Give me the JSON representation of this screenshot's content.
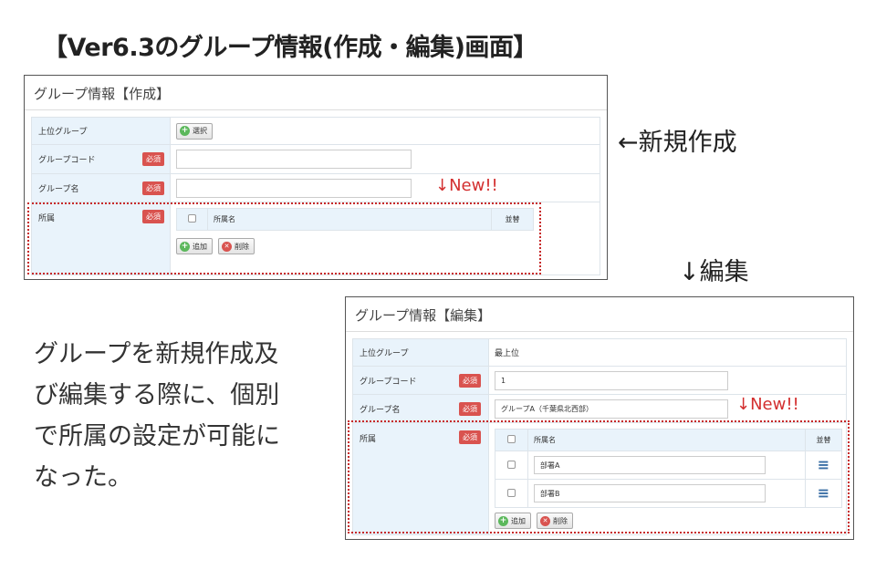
{
  "slide": {
    "title": "【Ver6.3のグループ情報(作成・編集)画面】",
    "create_note": "←新規作成",
    "edit_note": "↓編集",
    "new_marker": "↓New!!",
    "description_lines": [
      "グループを新規作成及",
      "び編集する際に、個別",
      "で所属の設定が可能に",
      "なった。"
    ]
  },
  "create_panel": {
    "heading": "グループ情報【作成】",
    "parent_group_label": "上位グループ",
    "select_button": "選択",
    "group_code_label": "グループコード",
    "group_name_label": "グループ名",
    "affiliation_label": "所属",
    "required_badge": "必須",
    "group_code_value": "",
    "group_name_value": "",
    "table_header_name": "所属名",
    "table_header_sort": "並替",
    "add_button": "追加",
    "delete_button": "削除"
  },
  "edit_panel": {
    "heading": "グループ情報【編集】",
    "parent_group_label": "上位グループ",
    "parent_group_value": "最上位",
    "group_code_label": "グループコード",
    "group_code_value": "1",
    "group_name_label": "グループ名",
    "group_name_value": "グループA（千葉県北西部）",
    "affiliation_label": "所属",
    "required_badge": "必須",
    "table_header_name": "所属名",
    "table_header_sort": "並替",
    "rows": [
      {
        "name": "部署A"
      },
      {
        "name": "部署B"
      }
    ],
    "add_button": "追加",
    "delete_button": "削除"
  },
  "icons": {
    "add": "plus-circle-icon",
    "delete": "x-circle-icon",
    "sort": "hamburger-icon"
  },
  "colors": {
    "required": "#d9534f",
    "new_marker": "#d32f2f",
    "label_bg": "#e9f3fb",
    "sort_icon": "#3a6ea5"
  }
}
